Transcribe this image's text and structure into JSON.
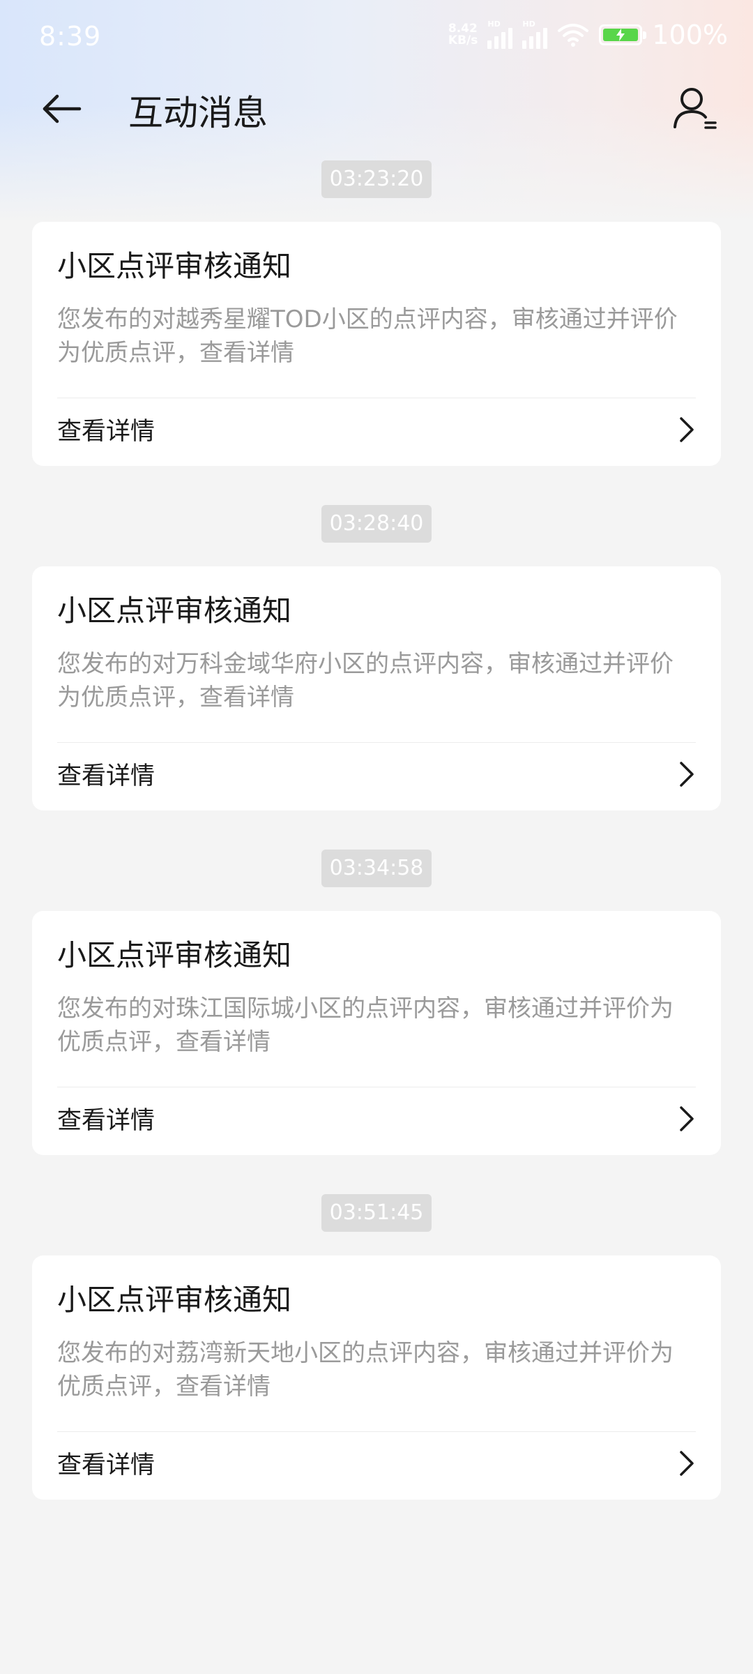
{
  "status_bar": {
    "time": "8:39",
    "net_speed_value": "8.42",
    "net_speed_unit": "KB/s",
    "hd_label": "HD",
    "battery_percent": "100%"
  },
  "header": {
    "title": "互动消息",
    "back_icon": "back-arrow-icon",
    "profile_icon": "user-profile-icon"
  },
  "messages": [
    {
      "timestamp": "03:23:20",
      "title": "小区点评审核通知",
      "body": "您发布的对越秀星耀TOD小区的点评内容，审核通过并评价为优质点评，查看详情",
      "action": "查看详情"
    },
    {
      "timestamp": "03:28:40",
      "title": "小区点评审核通知",
      "body": "您发布的对万科金域华府小区的点评内容，审核通过并评价为优质点评，查看详情",
      "action": "查看详情"
    },
    {
      "timestamp": "03:34:58",
      "title": "小区点评审核通知",
      "body": "您发布的对珠江国际城小区的点评内容，审核通过并评价为优质点评，查看详情",
      "action": "查看详情"
    },
    {
      "timestamp": "03:51:45",
      "title": "小区点评审核通知",
      "body": "您发布的对荔湾新天地小区的点评内容，审核通过并评价为优质点评，查看详情",
      "action": "查看详情"
    }
  ],
  "colors": {
    "timestamp_bg": "#dcdcdc",
    "card_bg": "#ffffff",
    "page_bg": "#f4f4f4",
    "battery_fill": "#59d64a"
  }
}
